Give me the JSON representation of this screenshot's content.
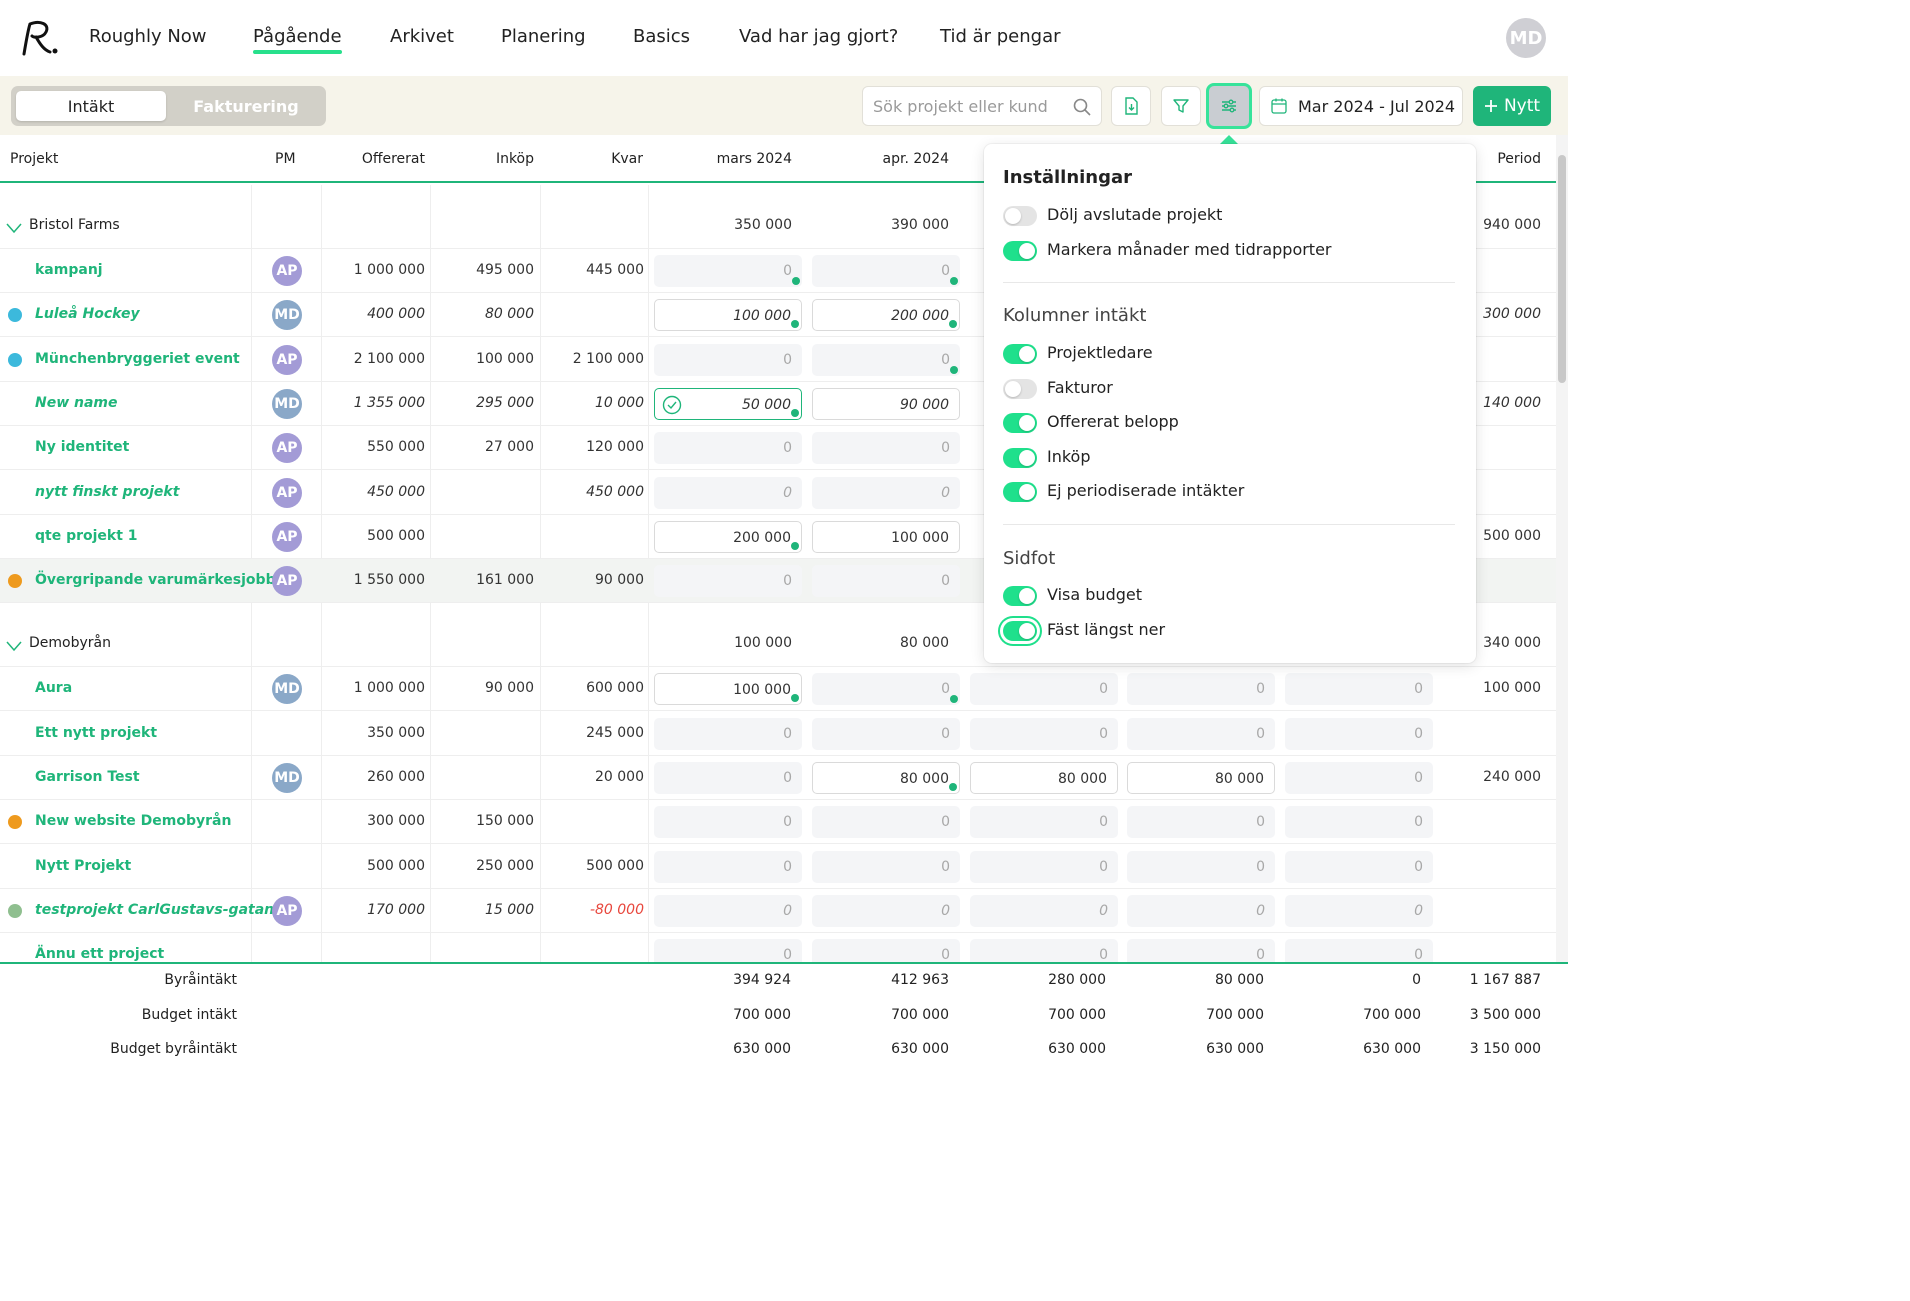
{
  "nav": {
    "items": [
      "Roughly Now",
      "Pågående",
      "Arkivet",
      "Planering",
      "Basics",
      "Vad har jag gjort?",
      "Tid är pengar"
    ],
    "active_index": 1,
    "user_initials": "MD"
  },
  "toolbar": {
    "seg_income": "Intäkt",
    "seg_invoicing": "Fakturering",
    "search_placeholder": "Sök projekt eller kund",
    "date_range": "Mar 2024 - Jul 2024",
    "new_label": "Nytt"
  },
  "table": {
    "headers": {
      "project": "Projekt",
      "pm": "PM",
      "offered": "Offererat",
      "purchase": "Inköp",
      "remaining": "Kvar",
      "m1": "mars 2024",
      "m2": "apr. 2024",
      "period": "Period"
    },
    "groups": [
      {
        "name": "Bristol Farms",
        "m1": "350 000",
        "m2": "390 000",
        "period": "940 000",
        "rows": [
          {
            "name": "kampanj",
            "italic": false,
            "dot": "",
            "pm": "AP",
            "offered": "1 000 000",
            "purchase": "495 000",
            "remaining": "445 000",
            "remaining_neg": false,
            "m1": "0",
            "m1_filled": false,
            "m1_sel": false,
            "m1_tick": true,
            "m2": "0",
            "m2_filled": false,
            "m2_tick": true,
            "period": ""
          },
          {
            "name": "Luleå Hockey",
            "italic": true,
            "dot": "#3cb9dc",
            "pm": "MD",
            "offered": "400 000",
            "purchase": "80 000",
            "remaining": "",
            "remaining_neg": false,
            "m1": "100 000",
            "m1_filled": true,
            "m1_sel": false,
            "m1_tick": true,
            "m2": "200 000",
            "m2_filled": true,
            "m2_tick": true,
            "period": "300 000"
          },
          {
            "name": "Münchenbryggeriet event",
            "italic": false,
            "dot": "#3cb9dc",
            "pm": "AP",
            "offered": "2 100 000",
            "purchase": "100 000",
            "remaining": "2 100 000",
            "remaining_neg": false,
            "m1": "0",
            "m1_filled": false,
            "m1_sel": false,
            "m1_tick": false,
            "m2": "0",
            "m2_filled": false,
            "m2_tick": true,
            "period": ""
          },
          {
            "name": "New name",
            "italic": true,
            "dot": "",
            "pm": "MD",
            "offered": "1 355 000",
            "purchase": "295 000",
            "remaining": "10 000",
            "remaining_neg": false,
            "m1": "50 000",
            "m1_filled": true,
            "m1_sel": true,
            "m1_tick": true,
            "m2": "90 000",
            "m2_filled": true,
            "m2_tick": false,
            "period": "140 000"
          },
          {
            "name": "Ny identitet",
            "italic": false,
            "dot": "",
            "pm": "AP",
            "offered": "550 000",
            "purchase": "27 000",
            "remaining": "120 000",
            "remaining_neg": false,
            "m1": "0",
            "m1_filled": false,
            "m1_sel": false,
            "m1_tick": false,
            "m2": "0",
            "m2_filled": false,
            "m2_tick": false,
            "period": ""
          },
          {
            "name": "nytt finskt projekt",
            "italic": true,
            "dot": "",
            "pm": "AP",
            "offered": "450 000",
            "purchase": "",
            "remaining": "450 000",
            "remaining_neg": false,
            "m1": "0",
            "m1_filled": false,
            "m1_sel": false,
            "m1_tick": false,
            "m2": "0",
            "m2_filled": false,
            "m2_tick": false,
            "period": ""
          },
          {
            "name": "qte projekt 1",
            "italic": false,
            "dot": "",
            "pm": "AP",
            "offered": "500 000",
            "purchase": "",
            "remaining": "",
            "remaining_neg": false,
            "m1": "200 000",
            "m1_filled": true,
            "m1_sel": false,
            "m1_tick": true,
            "m2": "100 000",
            "m2_filled": true,
            "m2_tick": false,
            "period": "500 000"
          },
          {
            "name": "Övergripande varumärkesjobb",
            "italic": false,
            "dot": "#ee9a1e",
            "pm": "AP",
            "offered": "1 550 000",
            "purchase": "161 000",
            "remaining": "90 000",
            "remaining_neg": false,
            "m1": "0",
            "m1_filled": false,
            "m1_sel": false,
            "m1_tick": false,
            "m2": "0",
            "m2_filled": false,
            "m2_tick": false,
            "period": "",
            "highlight": true
          }
        ]
      },
      {
        "name": "Demobyrån",
        "m1": "100 000",
        "m2": "80 000",
        "period": "340 000",
        "rows": [
          {
            "name": "Aura",
            "italic": false,
            "dot": "",
            "pm": "MD",
            "offered": "1 000 000",
            "purchase": "90 000",
            "remaining": "600 000",
            "remaining_neg": false,
            "m1": "100 000",
            "m1_filled": true,
            "m1_sel": false,
            "m1_tick": true,
            "m2": "0",
            "m2_filled": false,
            "m2_tick": true,
            "m3": "0",
            "m3_filled": false,
            "m4": "0",
            "m4_filled": false,
            "m5": "0",
            "period": "100 000"
          },
          {
            "name": "Ett nytt projekt",
            "italic": false,
            "dot": "",
            "pm": "",
            "offered": "350 000",
            "purchase": "",
            "remaining": "245 000",
            "remaining_neg": false,
            "m1": "0",
            "m1_filled": false,
            "m1_sel": false,
            "m1_tick": false,
            "m2": "0",
            "m2_filled": false,
            "m2_tick": false,
            "m3": "0",
            "m3_filled": false,
            "m4": "0",
            "m4_filled": false,
            "m5": "0",
            "period": ""
          },
          {
            "name": "Garrison Test",
            "italic": false,
            "dot": "",
            "pm": "MD",
            "offered": "260 000",
            "purchase": "",
            "remaining": "20 000",
            "remaining_neg": false,
            "m1": "0",
            "m1_filled": false,
            "m1_sel": false,
            "m1_tick": false,
            "m2": "80 000",
            "m2_filled": true,
            "m2_tick": true,
            "m3": "80 000",
            "m3_filled": true,
            "m4": "80 000",
            "m4_filled": true,
            "m5": "0",
            "period": "240 000"
          },
          {
            "name": "New website Demobyrån",
            "italic": false,
            "dot": "#ee9a1e",
            "pm": "",
            "offered": "300 000",
            "purchase": "150 000",
            "remaining": "",
            "remaining_neg": false,
            "m1": "0",
            "m1_filled": false,
            "m1_sel": false,
            "m1_tick": false,
            "m2": "0",
            "m2_filled": false,
            "m2_tick": false,
            "m3": "0",
            "m3_filled": false,
            "m4": "0",
            "m4_filled": false,
            "m5": "0",
            "period": ""
          },
          {
            "name": "Nytt Projekt",
            "italic": false,
            "dot": "",
            "pm": "",
            "offered": "500 000",
            "purchase": "250 000",
            "remaining": "500 000",
            "remaining_neg": false,
            "m1": "0",
            "m1_filled": false,
            "m1_sel": false,
            "m1_tick": false,
            "m2": "0",
            "m2_filled": false,
            "m2_tick": false,
            "m3": "0",
            "m3_filled": false,
            "m4": "0",
            "m4_filled": false,
            "m5": "0",
            "period": ""
          },
          {
            "name": "testprojekt CarlGustavs-gatan",
            "italic": true,
            "dot": "#8fbf8f",
            "pm": "AP",
            "offered": "170 000",
            "purchase": "15 000",
            "remaining": "-80 000",
            "remaining_neg": true,
            "m1": "0",
            "m1_filled": false,
            "m1_sel": false,
            "m1_tick": false,
            "m2": "0",
            "m2_filled": false,
            "m2_tick": false,
            "m3": "0",
            "m3_filled": false,
            "m4": "0",
            "m4_filled": false,
            "m5": "0",
            "period": ""
          },
          {
            "name": "Ännu ett project",
            "italic": false,
            "dot": "",
            "pm": "",
            "offered": "",
            "purchase": "",
            "remaining": "",
            "remaining_neg": false,
            "m1": "0",
            "m1_filled": false,
            "m1_sel": false,
            "m1_tick": false,
            "m2": "0",
            "m2_filled": false,
            "m2_tick": false,
            "m3": "0",
            "m3_filled": false,
            "m4": "0",
            "m4_filled": false,
            "m5": "0",
            "period": ""
          }
        ]
      }
    ]
  },
  "footer": {
    "rows": [
      {
        "label": "Byråintäkt",
        "values": [
          "394 924",
          "412 963",
          "280 000",
          "80 000",
          "0"
        ],
        "period": "1 167 887"
      },
      {
        "label": "Budget intäkt",
        "values": [
          "700 000",
          "700 000",
          "700 000",
          "700 000",
          "700 000"
        ],
        "period": "3 500 000"
      },
      {
        "label": "Budget byråintäkt",
        "values": [
          "630 000",
          "630 000",
          "630 000",
          "630 000",
          "630 000"
        ],
        "period": "3 150 000"
      }
    ]
  },
  "settings": {
    "title": "Inställningar",
    "general": [
      {
        "label": "Dölj avslutade projekt",
        "on": false
      },
      {
        "label": "Markera månader med tidrapporter",
        "on": true
      }
    ],
    "columns_heading": "Kolumner intäkt",
    "columns": [
      {
        "label": "Projektledare",
        "on": true
      },
      {
        "label": "Fakturor",
        "on": false
      },
      {
        "label": "Offererat belopp",
        "on": true
      },
      {
        "label": "Inköp",
        "on": true
      },
      {
        "label": "Ej periodiserade intäkter",
        "on": true
      }
    ],
    "footer_heading": "Sidfot",
    "footer": [
      {
        "label": "Visa budget",
        "on": true
      },
      {
        "label": "Fäst längst ner",
        "on": true,
        "focused": true
      }
    ]
  },
  "colors": {
    "accent": "#1fb57a",
    "toggle_on": "#1fe08c",
    "avatar_ap": "#a39bd6",
    "avatar_md": "#8aa8c8",
    "negative": "#e8473d"
  }
}
